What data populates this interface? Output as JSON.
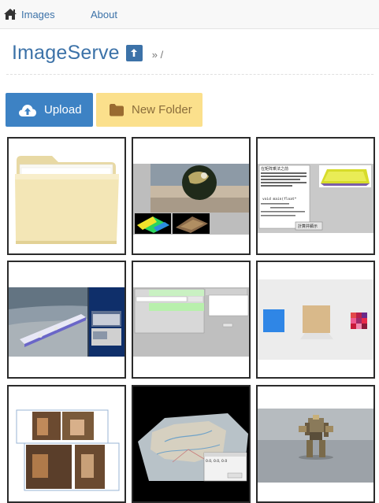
{
  "nav": {
    "images_label": "Images",
    "about_label": "About",
    "home_icon": "home-icon"
  },
  "header": {
    "title": "ImageServe",
    "up_icon": "arrow-up-icon",
    "breadcrumb": "» /"
  },
  "actions": {
    "upload_label": "Upload",
    "upload_icon": "cloud-upload-icon",
    "new_folder_label": "New Folder",
    "new_folder_icon": "folder-icon"
  },
  "tiles": {
    "t3": {
      "line1": "在矩阵乘法之前",
      "line2": "void main(float*",
      "button_label": "計算并顯示"
    },
    "t8": {
      "dialog_text": "0.0, 0.0, 0.0"
    }
  },
  "colors": {
    "accent": "#3c72a8",
    "upload_bg": "#3d82c4",
    "folder_bg": "#fbe08c",
    "tile_border": "#2b2b2b"
  }
}
